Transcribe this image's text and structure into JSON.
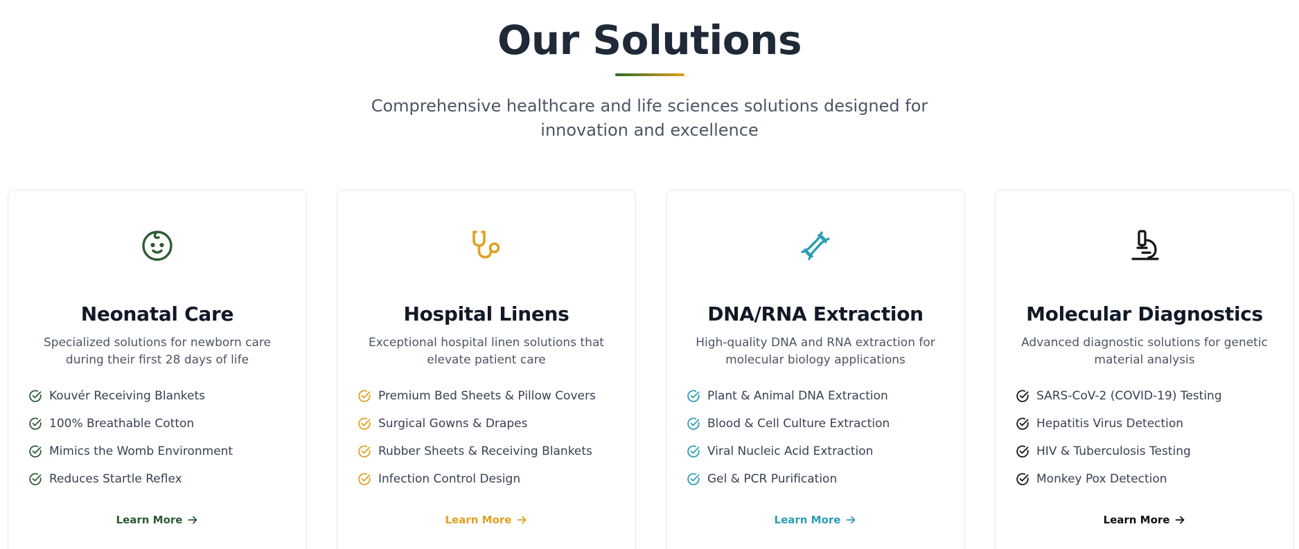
{
  "section": {
    "title": "Our Solutions",
    "subtitle": "Comprehensive healthcare and life sciences solutions designed for innovation and excellence"
  },
  "colors": {
    "green": "#2d5a32",
    "gold": "#e0a020",
    "teal": "#2b9db5",
    "black": "#111111"
  },
  "cards": [
    {
      "icon": "baby-face-icon",
      "accent": "#2d5a32",
      "title": "Neonatal Care",
      "description": "Specialized solutions for newborn care during their first 28 days of life",
      "features": [
        "Kouvér Receiving Blankets",
        "100% Breathable Cotton",
        "Mimics the Womb Environment",
        "Reduces Startle Reflex"
      ],
      "link_label": "Learn More"
    },
    {
      "icon": "stethoscope-icon",
      "accent": "#e0a020",
      "title": "Hospital Linens",
      "description": "Exceptional hospital linen solutions that elevate patient care",
      "features": [
        "Premium Bed Sheets & Pillow Covers",
        "Surgical Gowns & Drapes",
        "Rubber Sheets & Receiving Blankets",
        "Infection Control Design"
      ],
      "link_label": "Learn More"
    },
    {
      "icon": "dna-icon",
      "accent": "#2b9db5",
      "title": "DNA/RNA Extraction",
      "description": "High-quality DNA and RNA extraction for molecular biology applications",
      "features": [
        "Plant & Animal DNA Extraction",
        "Blood & Cell Culture Extraction",
        "Viral Nucleic Acid Extraction",
        "Gel & PCR Purification"
      ],
      "link_label": "Learn More"
    },
    {
      "icon": "microscope-icon",
      "accent": "#111111",
      "title": "Molecular Diagnostics",
      "description": "Advanced diagnostic solutions for genetic material analysis",
      "features": [
        "SARS-CoV-2 (COVID-19) Testing",
        "Hepatitis Virus Detection",
        "HIV & Tuberculosis Testing",
        "Monkey Pox Detection"
      ],
      "link_label": "Learn More"
    }
  ]
}
